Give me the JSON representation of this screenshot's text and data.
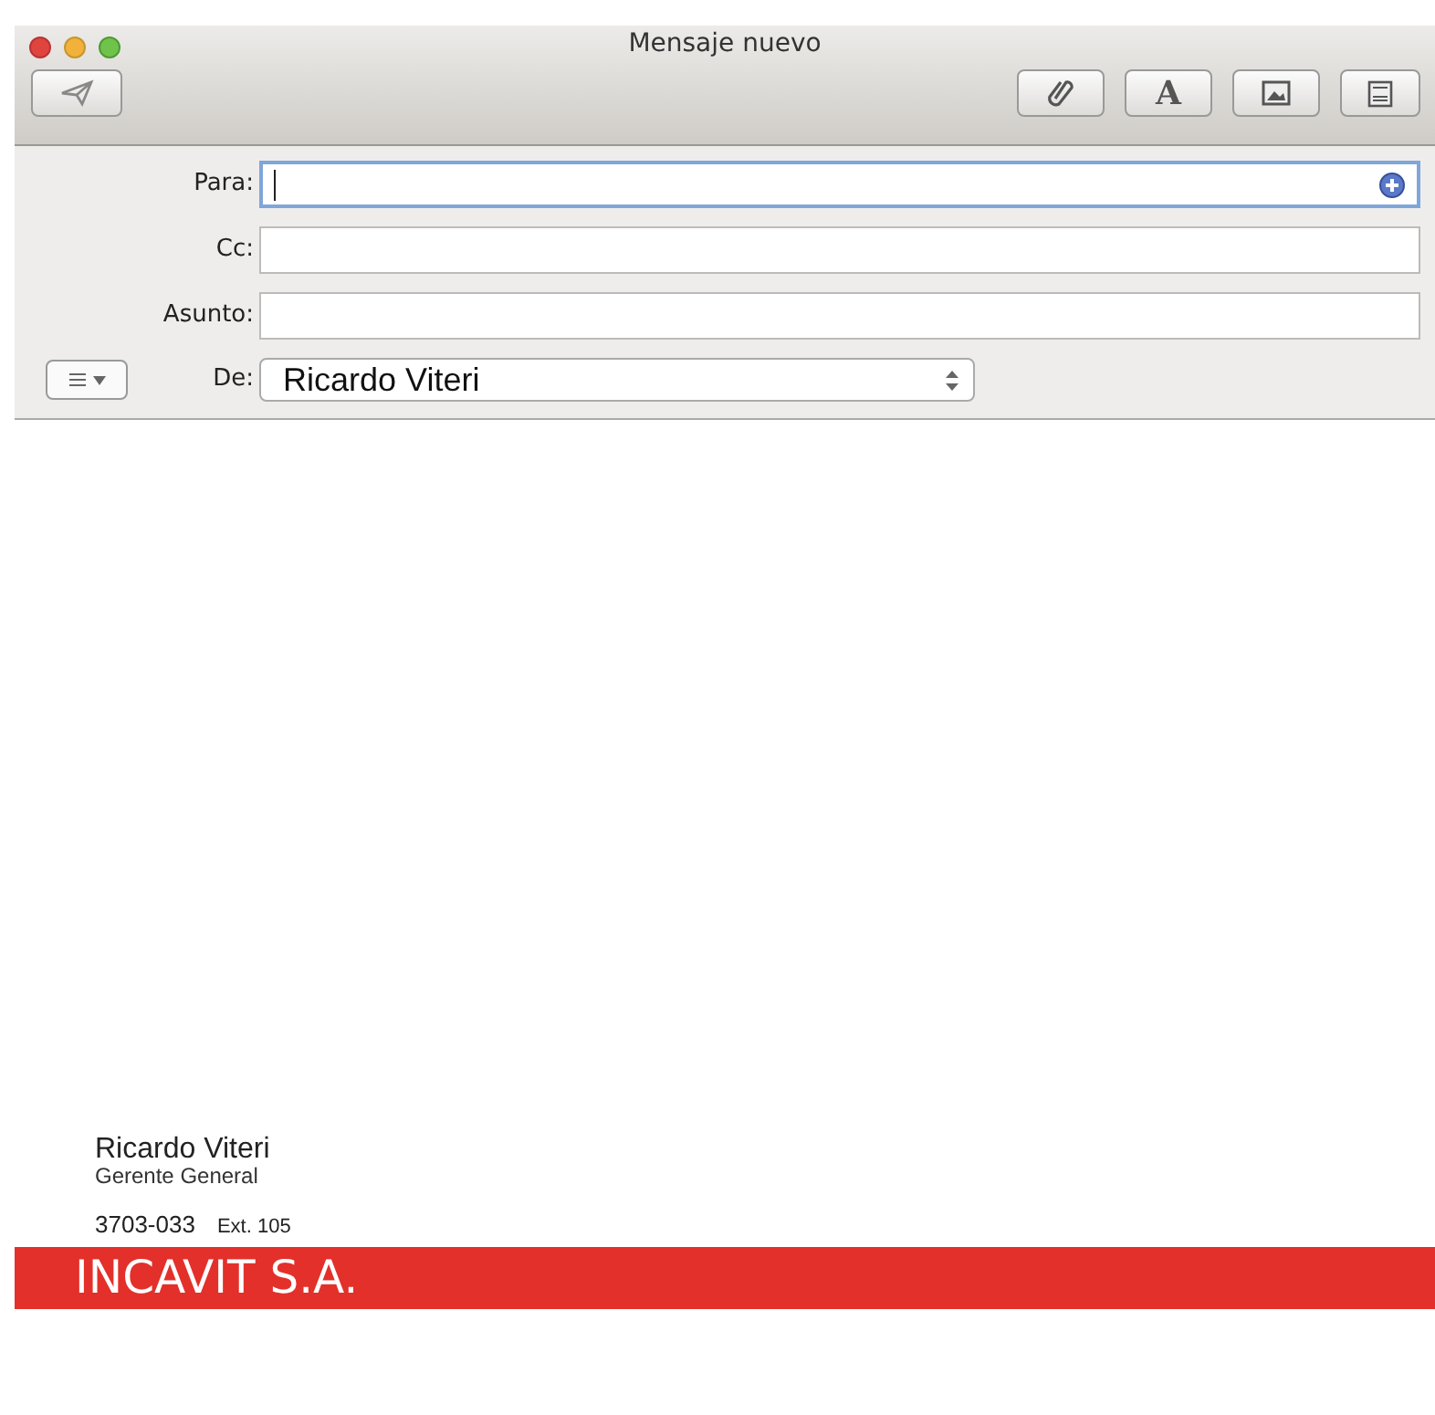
{
  "window": {
    "title": "Mensaje nuevo"
  },
  "toolbar": {
    "font_glyph": "A"
  },
  "fields": [
    {
      "label": "Para:",
      "kind": "recipients",
      "focused": true
    },
    {
      "label": "Cc:",
      "kind": "text",
      "focused": false
    },
    {
      "label": "Asunto:",
      "kind": "text",
      "focused": false
    }
  ],
  "from": {
    "label": "De:",
    "value": "Ricardo Viteri"
  },
  "signature": {
    "name": "Ricardo Viteri",
    "role": "Gerente General",
    "phone": "3703-033",
    "extension": "Ext. 105",
    "company": "INCAVIT S.A."
  }
}
